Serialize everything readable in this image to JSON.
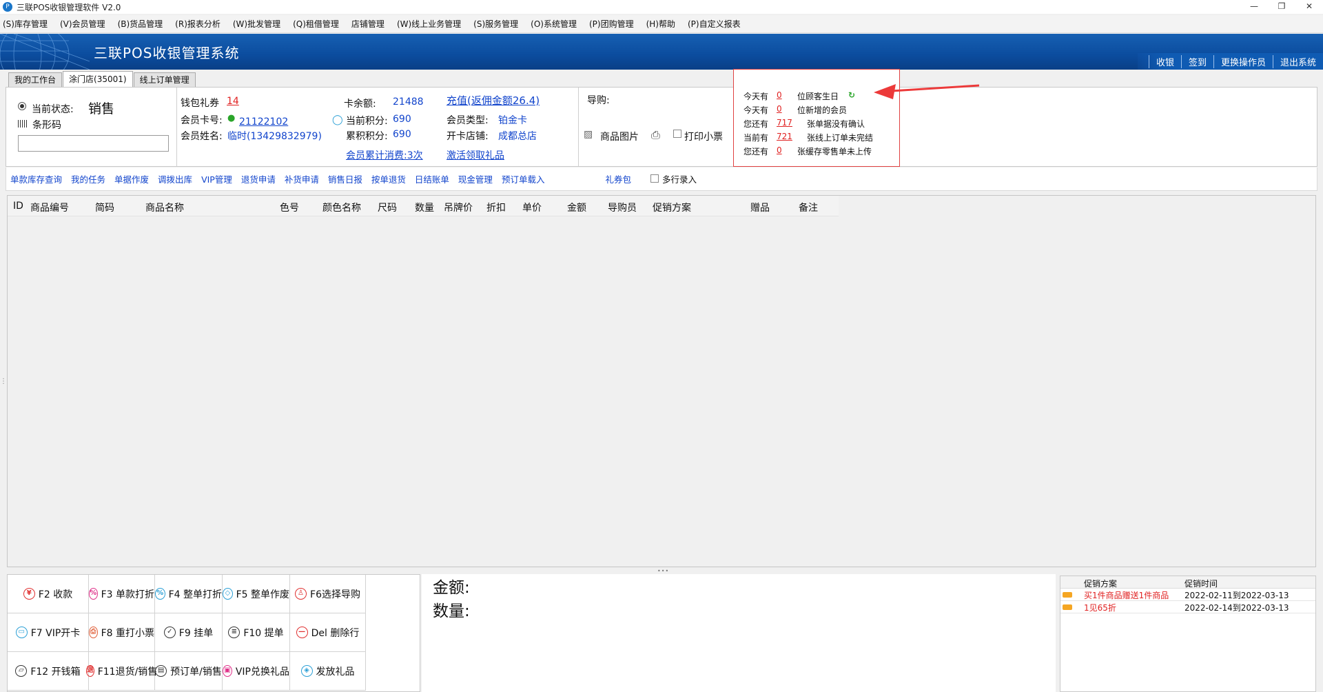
{
  "window": {
    "title": "三联POS收银管理软件 V2.0",
    "icon": "app-logo-icon"
  },
  "menu": [
    "(S)库存管理",
    "(V)会员管理",
    "(B)货品管理",
    "(R)报表分析",
    "(W)批发管理",
    "(Q)租借管理",
    "店铺管理",
    "(W)线上业务管理",
    "(S)服务管理",
    "(O)系统管理",
    "(P)团购管理",
    "(H)帮助",
    "(P)自定义报表"
  ],
  "banner": {
    "title": "三联POS收银管理系统",
    "links": [
      "收银",
      "签到",
      "更换操作员",
      "退出系统"
    ]
  },
  "tabs": [
    "我的工作台",
    "涂门店(35001)",
    "线上订单管理"
  ],
  "status": {
    "label": "当前状态:",
    "value": "销售",
    "barcode_label": "条形码",
    "barcode_value": ""
  },
  "member": {
    "wallet_label": "钱包礼券",
    "wallet_value": "14",
    "card_no_label": "会员卡号:",
    "card_no_value": "21122102",
    "name_label": "会员姓名:",
    "name_value": "临时(13429832979)",
    "balance_label": "卡余额:",
    "balance_value": "21488",
    "points_label": "当前积分:",
    "points_value": "690",
    "total_points_label": "累积积分:",
    "total_points_value": "690",
    "consume_link": "会员累计消费:3次",
    "recharge_link": "充值(返佣金额26.4)",
    "type_label": "会员类型:",
    "type_value": "铂金卡",
    "store_label": "开卡店铺:",
    "store_value": "成都总店",
    "activate_link": "激活领取礼品"
  },
  "guide": {
    "label": "导购:",
    "image_btn": "商品图片",
    "print_ticket": "打印小票"
  },
  "notices": [
    {
      "pre": "今天有",
      "num": "0",
      "text": "位顾客生日"
    },
    {
      "pre": "今天有",
      "num": "0",
      "text": "位新增的会员"
    },
    {
      "pre": "您还有",
      "num": "717",
      "text": "张单据没有确认"
    },
    {
      "pre": "当前有",
      "num": "721",
      "text": "张线上订单未完结"
    },
    {
      "pre": "您还有",
      "num": "0",
      "text": "张缓存零售单未上传"
    }
  ],
  "toolbar": [
    "单款库存查询",
    "我的任务",
    "单据作废",
    "调拨出库",
    "VIP管理",
    "退货申请",
    "补货申请",
    "销售日报",
    "按单退货",
    "日结账单",
    "现金管理",
    "预订单载入"
  ],
  "toolbar_extra": {
    "coupon": "礼券包",
    "multi_row": "多行录入"
  },
  "grid_columns": [
    "ID",
    "商品编号",
    "简码",
    "商品名称",
    "色号",
    "颜色名称",
    "尺码",
    "数量",
    "吊牌价",
    "折扣",
    "单价",
    "金额",
    "导购员",
    "促销方案",
    "赠品",
    "备注"
  ],
  "fkeys": [
    {
      "label": "F2 收款",
      "icon": "yuan-icon",
      "glyph": "¥",
      "color": "#e03030"
    },
    {
      "label": "F3 单款打折",
      "icon": "percent-icon",
      "glyph": "%",
      "color": "#e0308a"
    },
    {
      "label": "F4 整单打折",
      "icon": "percent-icon",
      "glyph": "%",
      "color": "#2a9fd6"
    },
    {
      "label": "F5 整单作废",
      "icon": "void-icon",
      "glyph": "◇",
      "color": "#2a9fd6"
    },
    {
      "label": "F6选择导购",
      "icon": "person-icon",
      "glyph": "♙",
      "color": "#e03030"
    },
    {
      "label": "F7 VIP开卡",
      "icon": "card-icon",
      "glyph": "▭",
      "color": "#2a9fd6"
    },
    {
      "label": "F8 重打小票",
      "icon": "reprint-icon",
      "glyph": "⎙",
      "color": "#e0603a"
    },
    {
      "label": "F9 挂单",
      "icon": "clipboard-check-icon",
      "glyph": "✓",
      "color": "#333333"
    },
    {
      "label": "F10 提单",
      "icon": "document-icon",
      "glyph": "≡",
      "color": "#333333"
    },
    {
      "label": "Del 删除行",
      "icon": "delete-icon",
      "glyph": "—",
      "color": "#e03030"
    },
    {
      "label": "F12 开钱箱",
      "icon": "cash-drawer-icon",
      "glyph": "▱",
      "color": "#333333"
    },
    {
      "label": "F11退货/销售",
      "icon": "return-icon",
      "glyph": "退",
      "color": "#e03030"
    },
    {
      "label": "预订单/销售",
      "icon": "order-icon",
      "glyph": "▤",
      "color": "#333333"
    },
    {
      "label": "VIP兑换礼品",
      "icon": "gift-icon",
      "glyph": "▣",
      "color": "#e0308a"
    },
    {
      "label": "发放礼品",
      "icon": "tag-icon",
      "glyph": "◈",
      "color": "#2a9fd6"
    }
  ],
  "summary": {
    "amount_label": "金额:",
    "quantity_label": "数量:"
  },
  "promotions": {
    "headers": [
      "促销方案",
      "促销时间"
    ],
    "rows": [
      {
        "name": "买1件商品赠送1件商品",
        "time": "2022-02-11到2022-03-13"
      },
      {
        "name": "1见65折",
        "time": "2022-02-14到2022-03-13"
      }
    ]
  },
  "colors": {
    "banner": "#0b4c9e",
    "link": "#1144cc",
    "alert": "#e02020"
  }
}
